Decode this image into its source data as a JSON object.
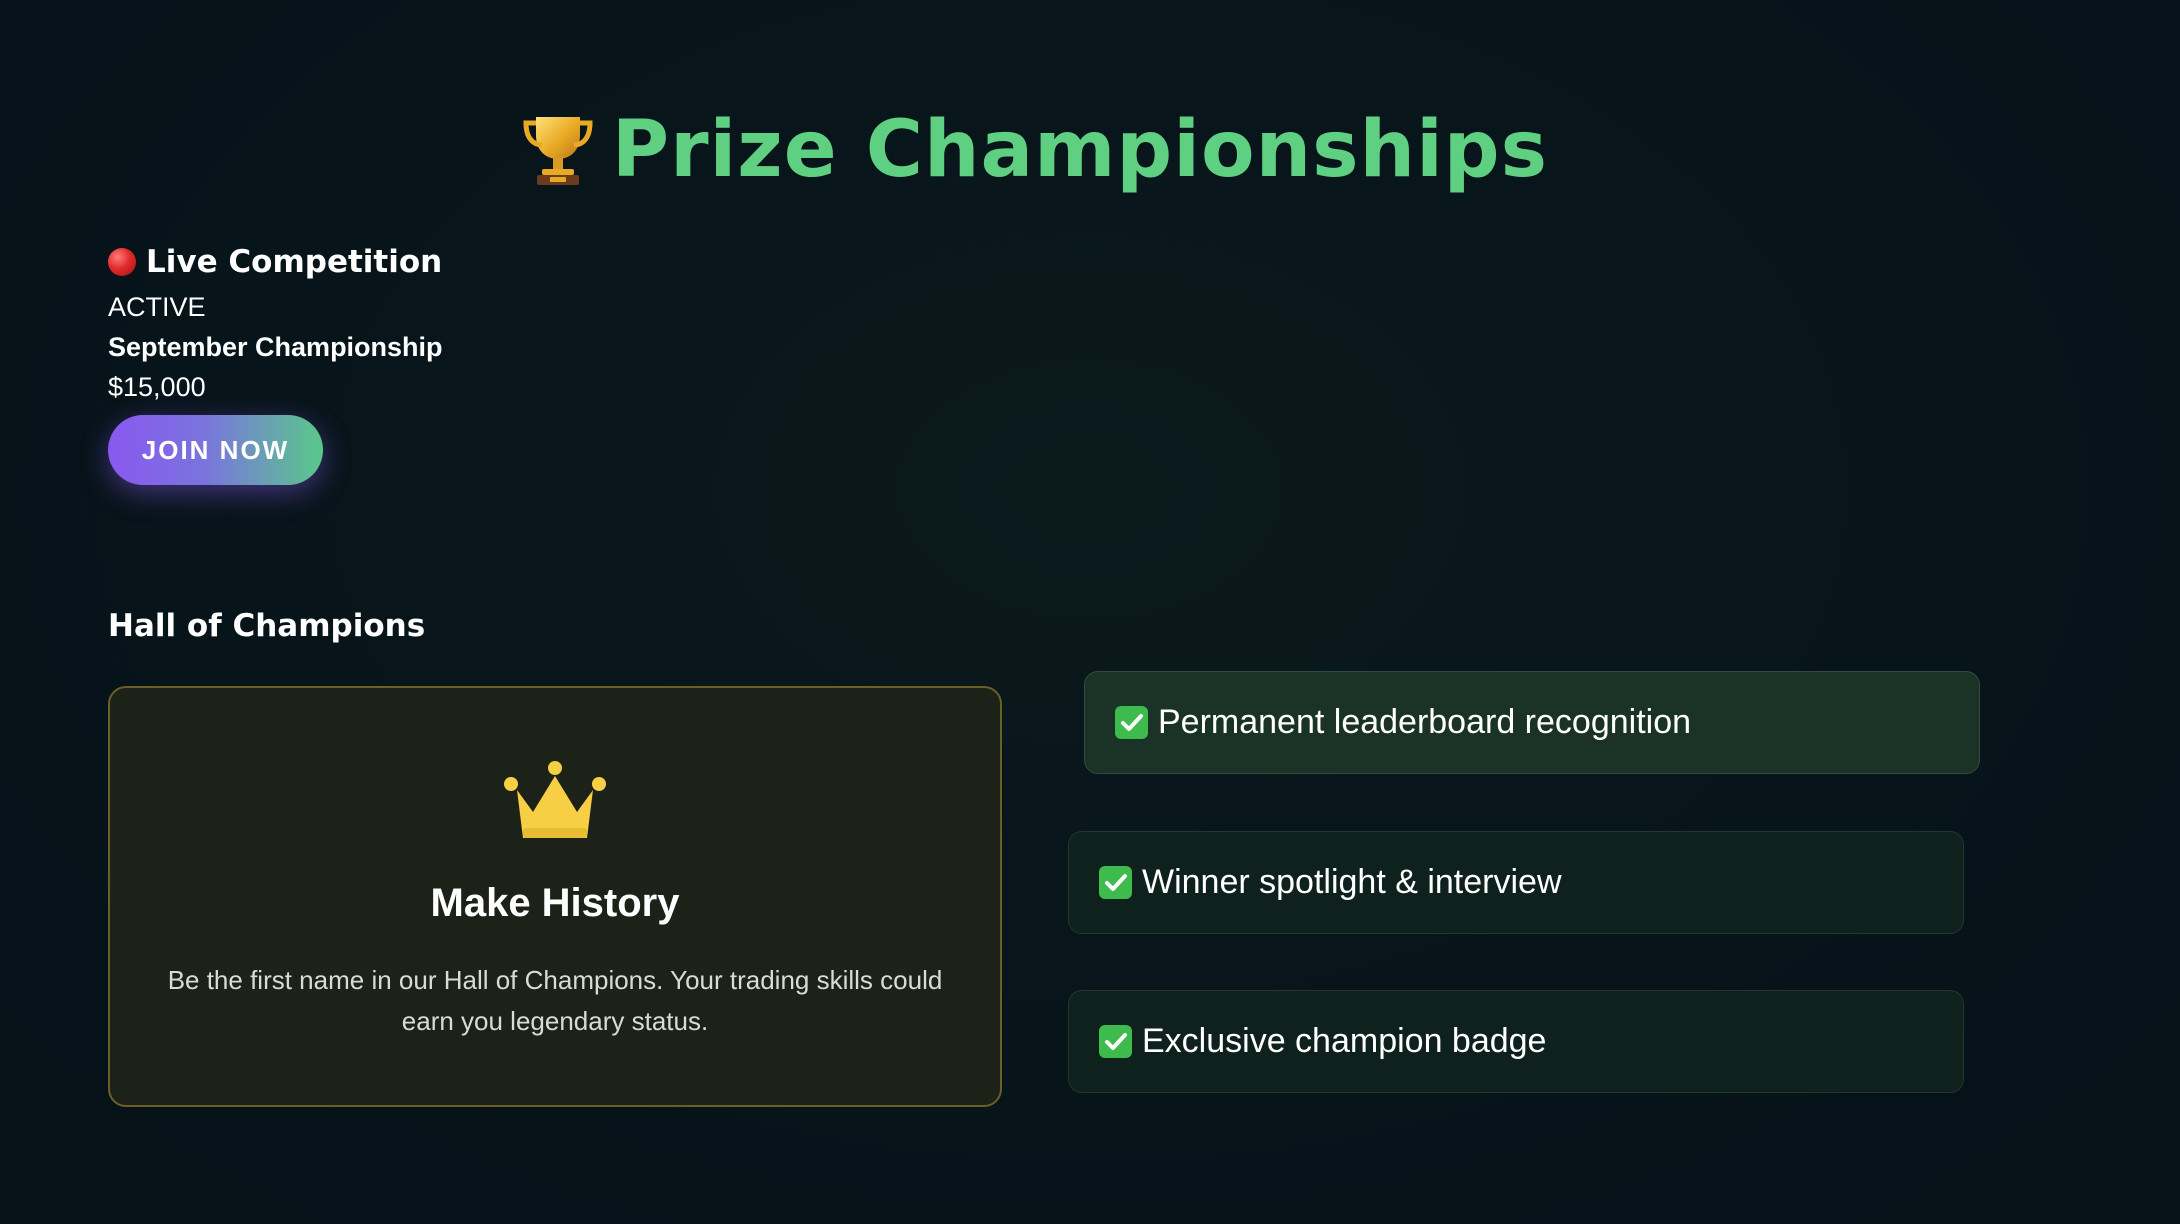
{
  "header": {
    "title": "Prize Championships",
    "trophy_icon": "trophy-icon",
    "title_color": "#5fcf82"
  },
  "live_competition": {
    "heading": "Live Competition",
    "status_icon": "red-circle-icon",
    "status": "ACTIVE",
    "name": "September Championship",
    "prize": "$15,000",
    "join_label": "JOIN NOW"
  },
  "hall": {
    "heading": "Hall of Champions",
    "card": {
      "icon": "crown-icon",
      "title": "Make History",
      "text": "Be the first name in our Hall of Champions. Your trading skills could earn you legendary status."
    },
    "benefits": [
      {
        "icon": "check-icon",
        "label": "Permanent leaderboard recognition"
      },
      {
        "icon": "check-icon",
        "label": "Winner spotlight & interview"
      },
      {
        "icon": "check-icon",
        "label": "Exclusive champion badge"
      }
    ]
  },
  "colors": {
    "accent_green": "#5fcf82",
    "button_gradient_start": "#8a58f0",
    "button_gradient_end": "#59c98a",
    "card_border": "#6a5f25",
    "check_green": "#3dbb4c"
  }
}
